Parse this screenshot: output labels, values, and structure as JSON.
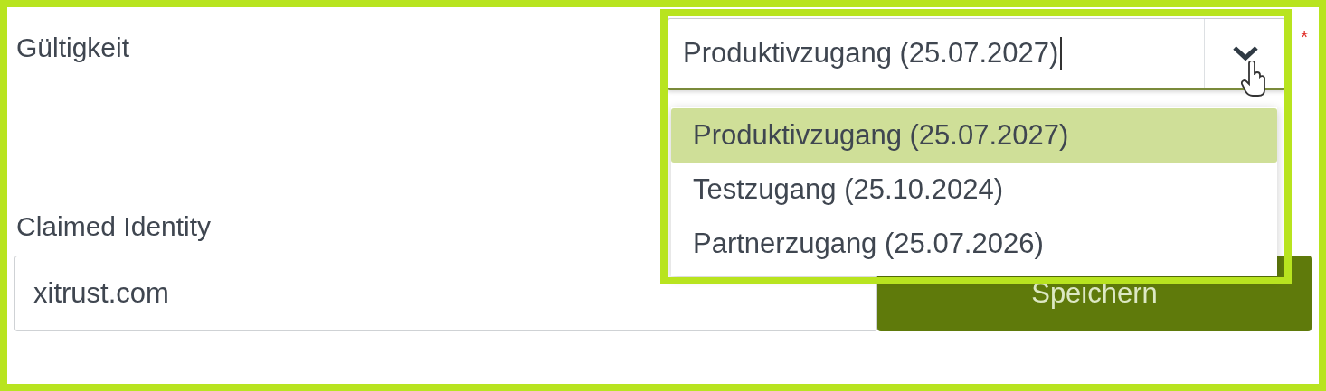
{
  "validity": {
    "label": "Gültigkeit",
    "required_mark": "*",
    "value": "Produktivzugang (25.07.2027)",
    "expanded": true,
    "options": [
      {
        "label": "Produktivzugang (25.07.2027)",
        "selected": true
      },
      {
        "label": "Testzugang (25.10.2024)",
        "selected": false
      },
      {
        "label": "Partnerzugang (25.07.2026)",
        "selected": false
      }
    ]
  },
  "claimed_identity": {
    "label": "Claimed Identity",
    "value": "xitrust.com"
  },
  "save_button": {
    "label": "Speichern"
  }
}
